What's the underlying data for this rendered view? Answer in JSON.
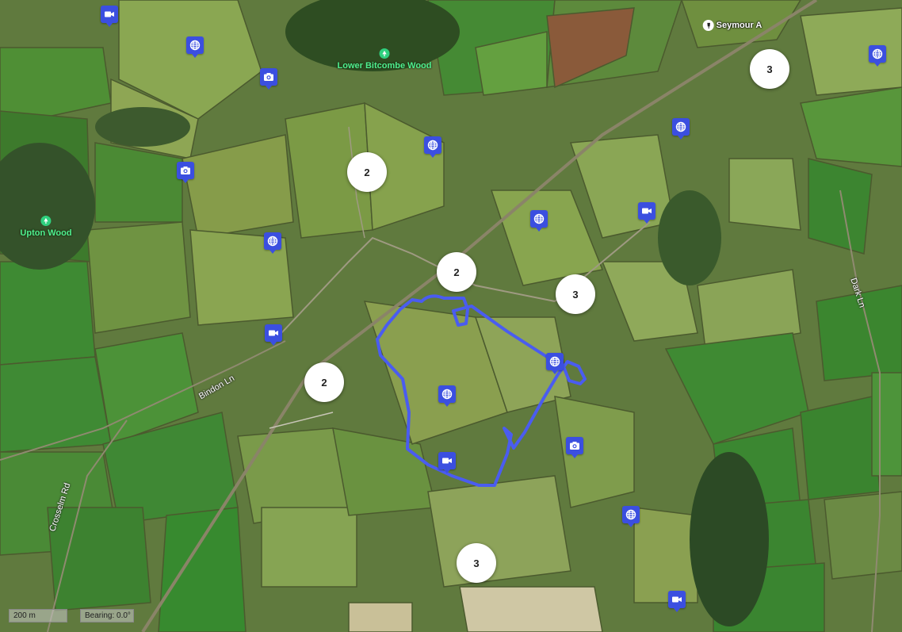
{
  "map": {
    "place_labels": [
      {
        "name": "Lower Bitcombe Wood",
        "icon": "tree-icon"
      },
      {
        "name": "Upton Wood",
        "icon": "tree-icon"
      }
    ],
    "road_labels": [
      "Bindon Ln",
      "Crosselm Rd",
      "Dark Ln"
    ],
    "poi_label": {
      "name": "Seymour A",
      "icon": "pub-icon"
    },
    "clusters": [
      {
        "count": "3"
      },
      {
        "count": "2"
      },
      {
        "count": "2"
      },
      {
        "count": "3"
      },
      {
        "count": "2"
      },
      {
        "count": "3"
      }
    ],
    "markers": [
      {
        "type": "video"
      },
      {
        "type": "web"
      },
      {
        "type": "photo"
      },
      {
        "type": "photo"
      },
      {
        "type": "web"
      },
      {
        "type": "web"
      },
      {
        "type": "web"
      },
      {
        "type": "web"
      },
      {
        "type": "video"
      },
      {
        "type": "video"
      },
      {
        "type": "web"
      },
      {
        "type": "web"
      },
      {
        "type": "video"
      },
      {
        "type": "photo"
      },
      {
        "type": "web"
      },
      {
        "type": "video"
      },
      {
        "type": "web"
      }
    ],
    "route_color": "#4a5cf0",
    "marker_color": "#3b4fe0"
  },
  "controls": {
    "scale": "200 m",
    "bearing": "Bearing: 0.0°"
  }
}
